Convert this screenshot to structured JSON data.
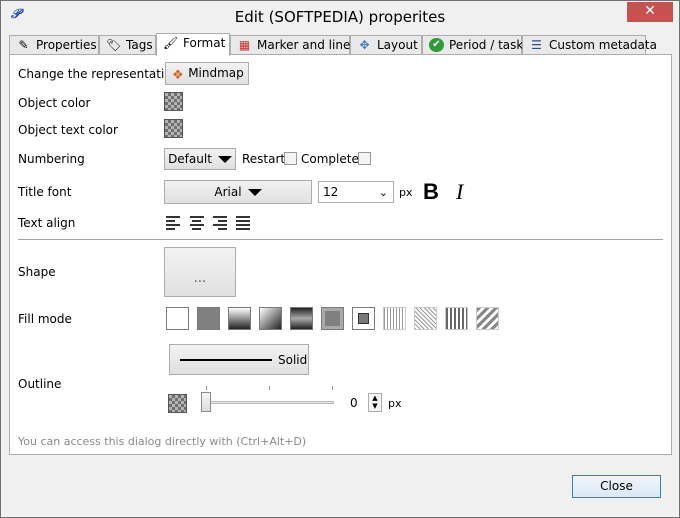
{
  "window": {
    "title": "Edit (SOFTPEDIA) properites",
    "close_glyph": "✕"
  },
  "tabs": [
    {
      "label": "Properties",
      "icon": "pencil-icon"
    },
    {
      "label": "Tags",
      "icon": "tag-icon"
    },
    {
      "label": "Format",
      "icon": "brush-icon",
      "active": true
    },
    {
      "label": "Marker and lines",
      "icon": "calendar-icon"
    },
    {
      "label": "Layout",
      "icon": "layout-icon"
    },
    {
      "label": "Period / task",
      "icon": "check-circle-icon"
    },
    {
      "label": "Custom metadata",
      "icon": "list-icon"
    }
  ],
  "format": {
    "representation_label": "Change the representation",
    "representation_button": "Mindmap",
    "object_color_label": "Object color",
    "object_text_color_label": "Object text color",
    "numbering_label": "Numbering",
    "numbering_value": "Default",
    "restart_label": "Restart",
    "complete_label": "Complete",
    "title_font_label": "Title font",
    "font_value": "Arial",
    "size_value": "12",
    "size_unit": "px",
    "bold_glyph": "B",
    "italic_glyph": "I",
    "text_align_label": "Text align",
    "shape_label": "Shape",
    "shape_button": "...",
    "fill_mode_label": "Fill mode",
    "outline_label": "Outline",
    "outline_style": "Solid",
    "outline_width": "0",
    "outline_unit": "px",
    "hint": "You can access this dialog directly with (Ctrl+Alt+D)"
  },
  "footer": {
    "close_label": "Close"
  },
  "colors": {
    "close_red": "#c75050",
    "accent_blue": "#3c7fb1"
  }
}
